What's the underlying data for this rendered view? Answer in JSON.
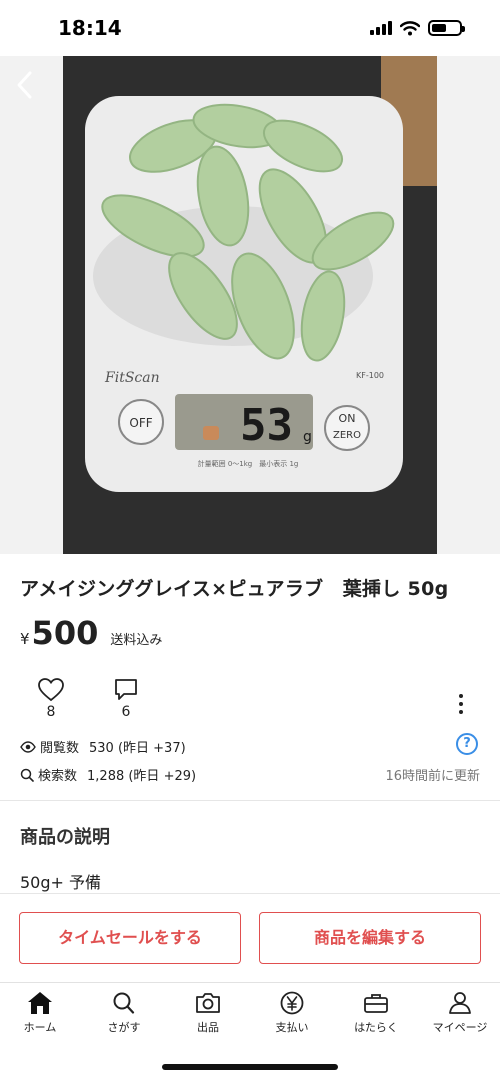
{
  "status_bar": {
    "time": "18:14"
  },
  "item": {
    "title": "アメイジンググレイス×ピュアラブ　葉挿し 50g",
    "currency_symbol": "¥",
    "price": "500",
    "shipping_note": "送料込み",
    "likes": "8",
    "comments": "6",
    "views_label": "閲覧数",
    "views_value": "530 (昨日 +37)",
    "searches_label": "検索数",
    "searches_value": "1,288 (昨日 +29)",
    "updated": "16時間前に更新",
    "help_glyph": "?"
  },
  "description": {
    "heading": "商品の説明",
    "body": "50g+ 予備"
  },
  "photo": {
    "scale_brand": "FitScan",
    "scale_model": "KF-100",
    "scale_reading": "53",
    "scale_unit": "g",
    "off_label": "OFF",
    "on_label": "ON",
    "zero_label": "ZERO",
    "range_text": "計量範囲 0～1kg　最小表示 1g"
  },
  "actions": {
    "time_sale": "タイムセールをする",
    "edit_item": "商品を編集する"
  },
  "tab_bar": {
    "items": [
      {
        "label": "ホーム",
        "icon": "home-icon"
      },
      {
        "label": "さがす",
        "icon": "search-icon"
      },
      {
        "label": "出品",
        "icon": "camera-icon"
      },
      {
        "label": "支払い",
        "icon": "yen-icon"
      },
      {
        "label": "はたらく",
        "icon": "briefcase-icon"
      },
      {
        "label": "マイページ",
        "icon": "person-icon"
      }
    ]
  },
  "colors": {
    "accent": "#e04f4f",
    "help": "#3a8ee6",
    "leaf": "#a9c79a"
  }
}
